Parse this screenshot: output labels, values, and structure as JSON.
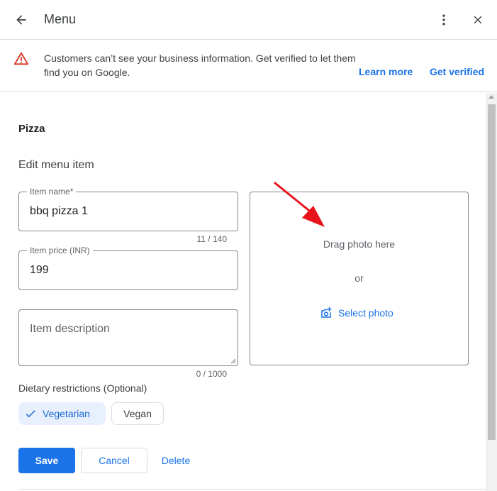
{
  "header": {
    "title": "Menu",
    "icons": {
      "back": "arrow-back-icon",
      "more": "more-vert-icon",
      "close": "close-icon"
    }
  },
  "banner": {
    "text": "Customers can’t see your business information. Get verified to let them find you on Google.",
    "learn_more": "Learn more",
    "get_verified": "Get verified",
    "icon": "warning-icon",
    "warning_color": "#d93025"
  },
  "form": {
    "section_title": "Pizza",
    "subtitle": "Edit menu item",
    "item_name": {
      "label": "Item name*",
      "value": "bbq pizza 1",
      "counter": "11 / 140"
    },
    "item_price": {
      "label": "Item price (INR)",
      "value": "199"
    },
    "item_description": {
      "placeholder": "Item description",
      "counter": "0 / 1000"
    },
    "photo": {
      "drag_text": "Drag photo here",
      "or_text": "or",
      "select_label": "Select photo",
      "select_icon": "add-photo-icon"
    },
    "dietary": {
      "label": "Dietary restrictions (Optional)",
      "options": [
        {
          "label": "Vegetarian",
          "selected": true
        },
        {
          "label": "Vegan",
          "selected": false
        }
      ]
    },
    "actions": {
      "save": "Save",
      "cancel": "Cancel",
      "delete": "Delete"
    }
  },
  "colors": {
    "accent": "#1a73e8",
    "annotation_arrow": "#e8131b"
  }
}
